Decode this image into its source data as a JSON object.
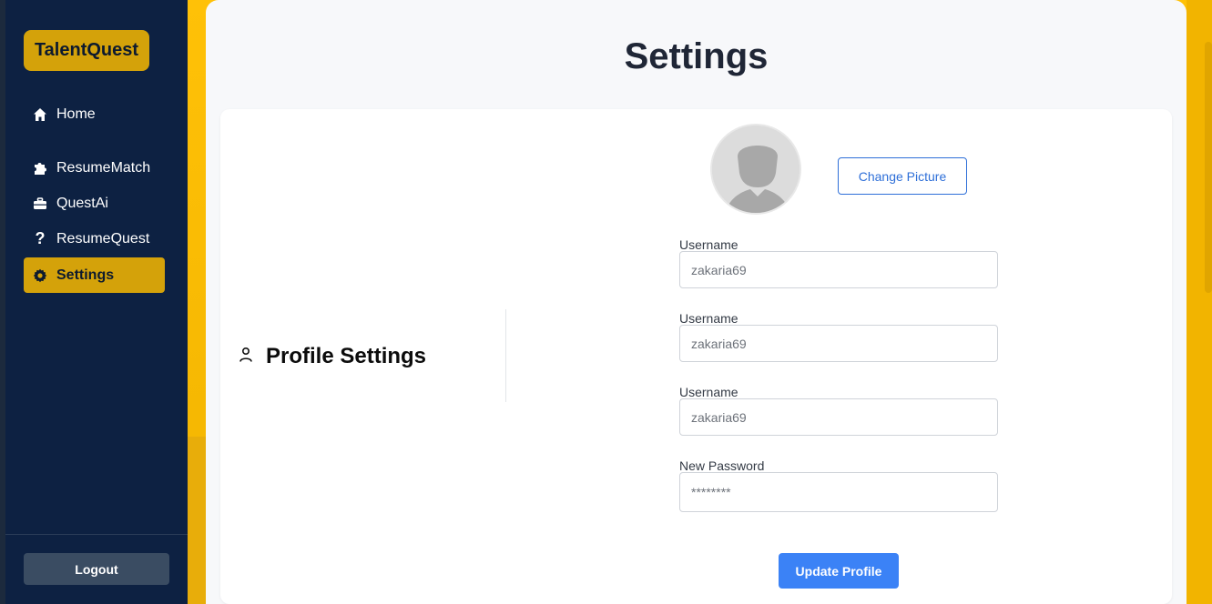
{
  "brand": {
    "name": "TalentQuest"
  },
  "sidebar": {
    "items": [
      {
        "label": "Home",
        "icon": "home-icon"
      },
      {
        "label": "ResumeMatch",
        "icon": "puzzle-icon"
      },
      {
        "label": "QuestAi",
        "icon": "briefcase-icon"
      },
      {
        "label": "ResumeQuest",
        "icon": "question-icon"
      },
      {
        "label": "Settings",
        "icon": "gear-icon",
        "active": true
      }
    ],
    "logout_label": "Logout"
  },
  "page": {
    "title": "Settings"
  },
  "profile": {
    "section_title": "Profile Settings",
    "change_picture_label": "Change Picture",
    "fields": [
      {
        "label": "Username",
        "placeholder": "zakaria69"
      },
      {
        "label": "Username",
        "placeholder": "zakaria69"
      },
      {
        "label": "Username",
        "placeholder": "zakaria69"
      },
      {
        "label": "New Password",
        "placeholder": "********"
      }
    ],
    "update_label": "Update Profile"
  },
  "colors": {
    "sidebar_bg": "#0d2142",
    "accent_gold": "#d4a20a",
    "primary_blue": "#3b82f6",
    "background_yellow": "#ffc107"
  }
}
